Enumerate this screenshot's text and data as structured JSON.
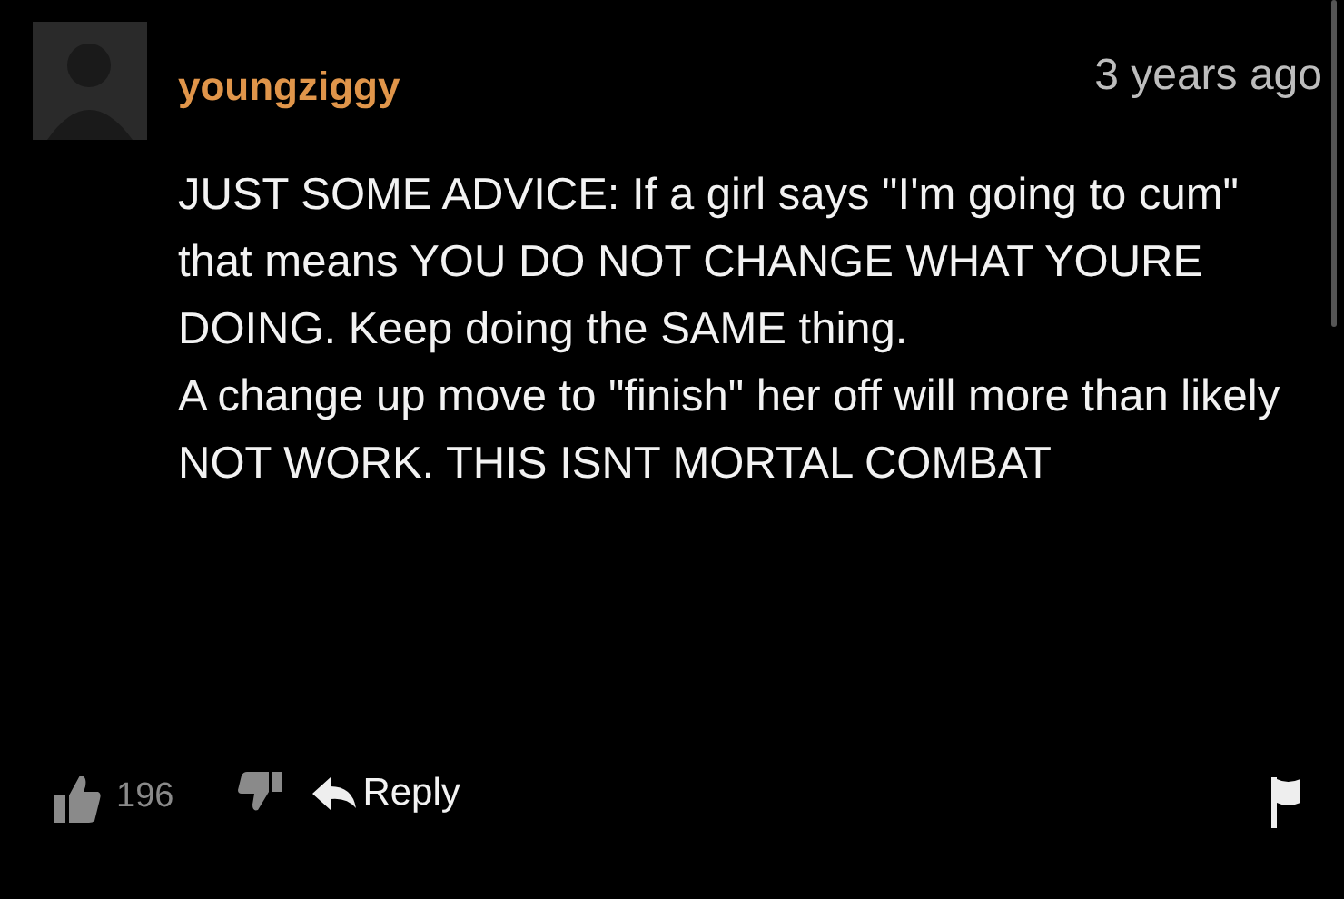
{
  "comment": {
    "username": "youngziggy",
    "time": "3 years ago",
    "paragraphs": [
      "JUST SOME ADVICE: If a girl says \"I'm going to cum\" that means YOU DO NOT CHANGE WHAT YOURE DOING. Keep doing the SAME thing.",
      "A change up move to \"finish\" her off will more than likely NOT WORK. THIS ISNT MORTAL COMBAT"
    ],
    "likes": "196",
    "reply_label": "Reply"
  }
}
